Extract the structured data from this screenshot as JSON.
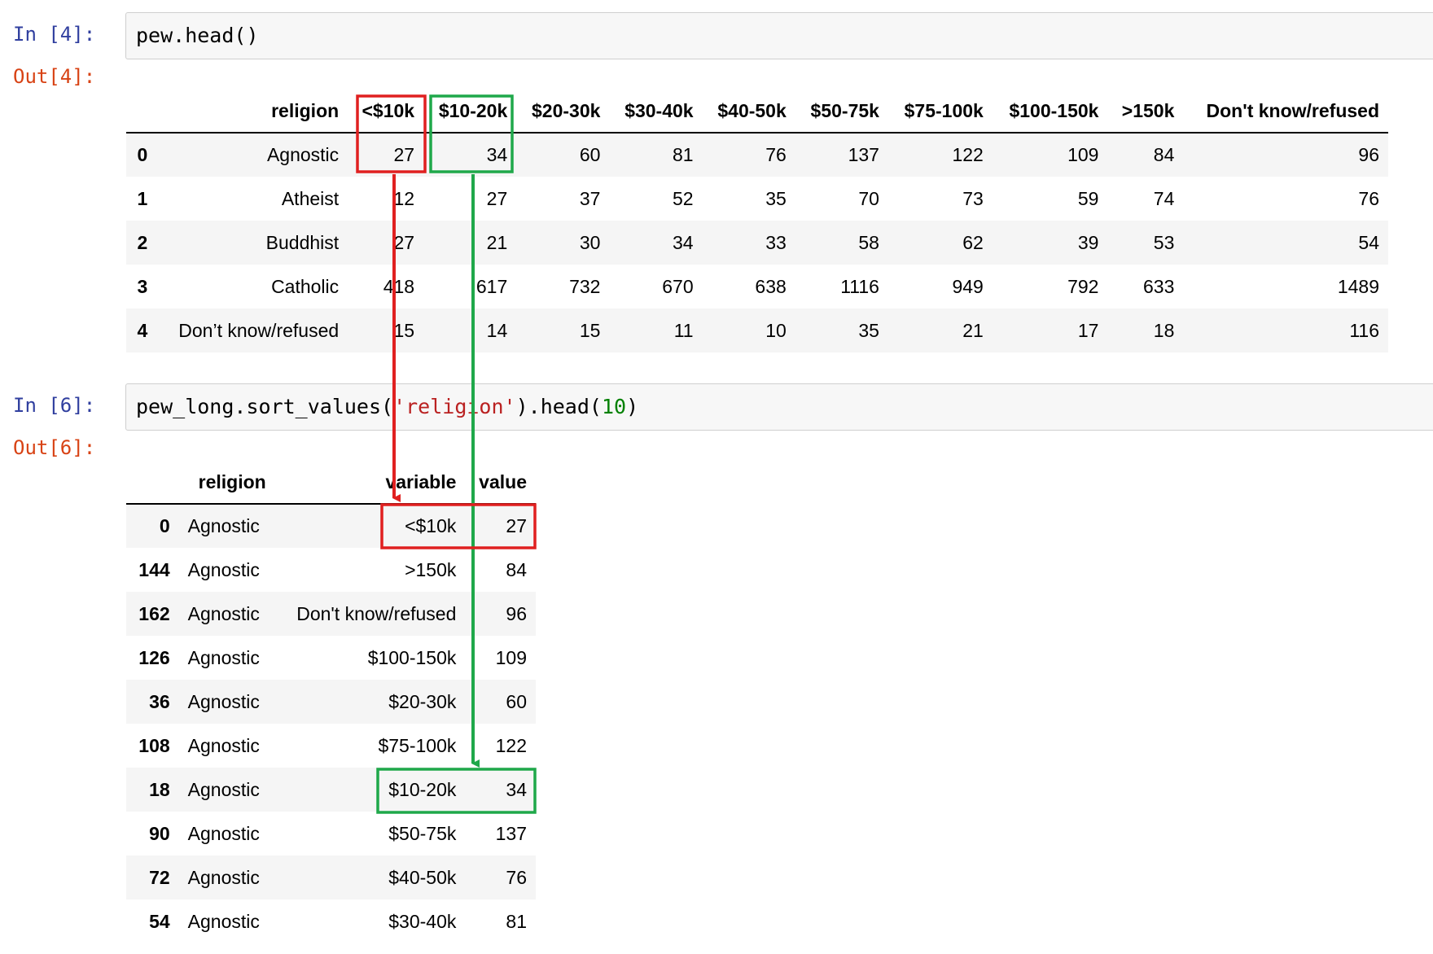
{
  "cell1": {
    "in_prompt": "In [4]:",
    "code": "pew.head()",
    "out_prompt": "Out[4]:",
    "table": {
      "columns": [
        "religion",
        "<$10k",
        "$10-20k",
        "$20-30k",
        "$30-40k",
        "$40-50k",
        "$50-75k",
        "$75-100k",
        "$100-150k",
        ">150k",
        "Don't know/refused"
      ],
      "rows": [
        {
          "index": "0",
          "cells": [
            "Agnostic",
            "27",
            "34",
            "60",
            "81",
            "76",
            "137",
            "122",
            "109",
            "84",
            "96"
          ]
        },
        {
          "index": "1",
          "cells": [
            "Atheist",
            "12",
            "27",
            "37",
            "52",
            "35",
            "70",
            "73",
            "59",
            "74",
            "76"
          ]
        },
        {
          "index": "2",
          "cells": [
            "Buddhist",
            "27",
            "21",
            "30",
            "34",
            "33",
            "58",
            "62",
            "39",
            "53",
            "54"
          ]
        },
        {
          "index": "3",
          "cells": [
            "Catholic",
            "418",
            "617",
            "732",
            "670",
            "638",
            "1116",
            "949",
            "792",
            "633",
            "1489"
          ]
        },
        {
          "index": "4",
          "cells": [
            "Don’t know/refused",
            "15",
            "14",
            "15",
            "11",
            "10",
            "35",
            "21",
            "17",
            "18",
            "116"
          ]
        }
      ]
    }
  },
  "cell2": {
    "in_prompt": "In [6]:",
    "code_pre": "pew_long.sort_values(",
    "code_str": "'religion'",
    "code_mid": ").head(",
    "code_num": "10",
    "code_post": ")",
    "out_prompt": "Out[6]:",
    "table": {
      "columns": [
        "religion",
        "variable",
        "value"
      ],
      "rows": [
        {
          "index": "0",
          "cells": [
            "Agnostic",
            "<$10k",
            "27"
          ]
        },
        {
          "index": "144",
          "cells": [
            "Agnostic",
            ">150k",
            "84"
          ]
        },
        {
          "index": "162",
          "cells": [
            "Agnostic",
            "Don't know/refused",
            "96"
          ]
        },
        {
          "index": "126",
          "cells": [
            "Agnostic",
            "$100-150k",
            "109"
          ]
        },
        {
          "index": "36",
          "cells": [
            "Agnostic",
            "$20-30k",
            "60"
          ]
        },
        {
          "index": "108",
          "cells": [
            "Agnostic",
            "$75-100k",
            "122"
          ]
        },
        {
          "index": "18",
          "cells": [
            "Agnostic",
            "$10-20k",
            "34"
          ]
        },
        {
          "index": "90",
          "cells": [
            "Agnostic",
            "$50-75k",
            "137"
          ]
        },
        {
          "index": "72",
          "cells": [
            "Agnostic",
            "$40-50k",
            "76"
          ]
        },
        {
          "index": "54",
          "cells": [
            "Agnostic",
            "$30-40k",
            "81"
          ]
        }
      ]
    }
  },
  "annotations": {
    "red_color": "#e02020",
    "green_color": "#1fa84a"
  }
}
